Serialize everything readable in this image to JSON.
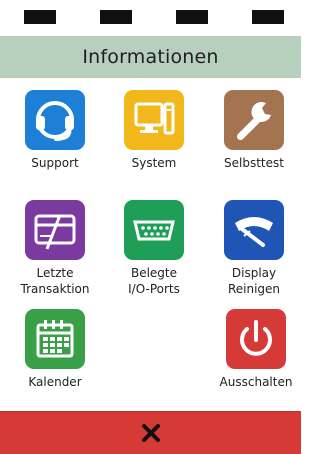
{
  "header": {
    "title": "Informationen"
  },
  "tiles": [
    {
      "label": "Support",
      "icon": "headset-icon",
      "color": "#1d7fd6"
    },
    {
      "label": "System",
      "icon": "monitor-icon",
      "color": "#f2b81b"
    },
    {
      "label": "Selbsttest",
      "icon": "wrench-icon",
      "color": "#a47451"
    },
    {
      "label": "Letzte\nTransaktion",
      "icon": "card-signature-icon",
      "color": "#7a3aa0"
    },
    {
      "label": "Belegte\nI/O-Ports",
      "icon": "serial-port-icon",
      "color": "#1f9e57"
    },
    {
      "label": "Display\nReinigen",
      "icon": "wiper-icon",
      "color": "#1f56b5"
    },
    {
      "label": "Kalender",
      "icon": "calendar-icon",
      "color": "#3aa048"
    },
    {
      "label": "Ausschalten",
      "icon": "power-icon",
      "color": "#d63a36"
    }
  ],
  "footer": {
    "icon": "close-icon",
    "color": "#d63a36"
  }
}
